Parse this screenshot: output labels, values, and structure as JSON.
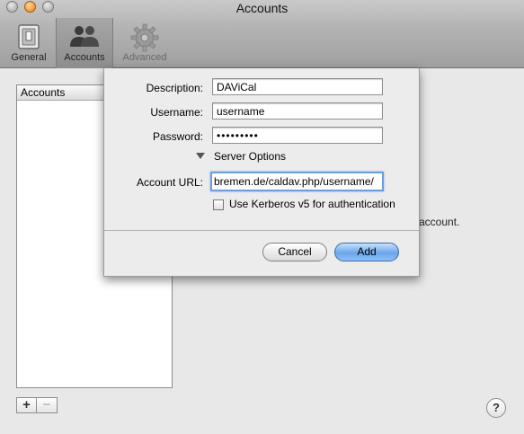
{
  "window": {
    "title": "Accounts"
  },
  "toolbar": {
    "general_label": "General",
    "accounts_label": "Accounts",
    "advanced_label": "Advanced"
  },
  "sidebar": {
    "header": "Accounts"
  },
  "background": {
    "hint_text": "account."
  },
  "sheet": {
    "description_label": "Description:",
    "description_value": "DAViCal",
    "username_label": "Username:",
    "username_value": "username",
    "password_label": "Password:",
    "password_value": "•••••••••",
    "server_options_label": "Server Options",
    "account_url_label": "Account URL:",
    "account_url_value": "bremen.de/caldav.php/username/",
    "kerberos_label": "Use Kerberos v5 for authentication",
    "cancel_label": "Cancel",
    "add_label": "Add"
  },
  "controls": {
    "plus": "+",
    "minus": "−",
    "help": "?"
  },
  "colors": {
    "focus_ring": "#6d9ddb",
    "default_button": "#6aa6ec"
  }
}
